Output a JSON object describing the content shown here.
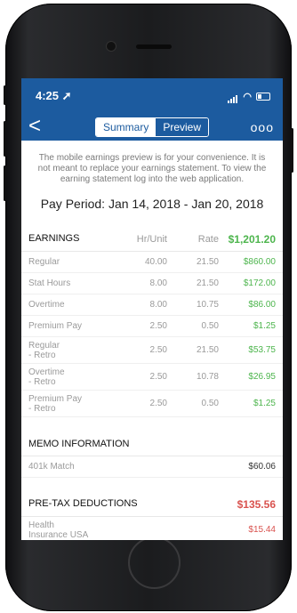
{
  "status_bar": {
    "time": "4:25"
  },
  "nav": {
    "back_label": "<",
    "tabs": [
      {
        "label": "Summary",
        "active": false
      },
      {
        "label": "Preview",
        "active": true
      }
    ],
    "more_label": "ooo",
    "color": "#1c5b9f"
  },
  "notice": "The mobile earnings preview is for your convenience. It is not meant to replace your earnings statement. To view the earning statement log into the web application.",
  "pay_period": "Pay Period: Jan 14, 2018 - Jan 20, 2018",
  "earnings": {
    "header": {
      "label": "EARNINGS",
      "hr": "Hr/Unit",
      "rate": "Rate",
      "total": "$1,201.20"
    },
    "rows": [
      {
        "name": "Regular",
        "hr": "40.00",
        "rate": "21.50",
        "amount": "$860.00"
      },
      {
        "name": "Stat Hours",
        "hr": "8.00",
        "rate": "21.50",
        "amount": "$172.00"
      },
      {
        "name": "Overtime",
        "hr": "8.00",
        "rate": "10.75",
        "amount": "$86.00"
      },
      {
        "name": "Premium Pay",
        "hr": "2.50",
        "rate": "0.50",
        "amount": "$1.25"
      },
      {
        "name": "Regular\n- Retro",
        "hr": "2.50",
        "rate": "21.50",
        "amount": "$53.75"
      },
      {
        "name": "Overtime\n- Retro",
        "hr": "2.50",
        "rate": "10.78",
        "amount": "$26.95"
      },
      {
        "name": "Premium Pay\n- Retro",
        "hr": "2.50",
        "rate": "0.50",
        "amount": "$1.25"
      }
    ]
  },
  "memo": {
    "header": "MEMO INFORMATION",
    "rows": [
      {
        "name": "401k Match",
        "amount": "$60.06"
      }
    ]
  },
  "pretax": {
    "header": "PRE-TAX DEDUCTIONS",
    "total": "$135.56",
    "rows": [
      {
        "name": "Health\nInsurance USA",
        "amount": "$15.44"
      }
    ]
  }
}
